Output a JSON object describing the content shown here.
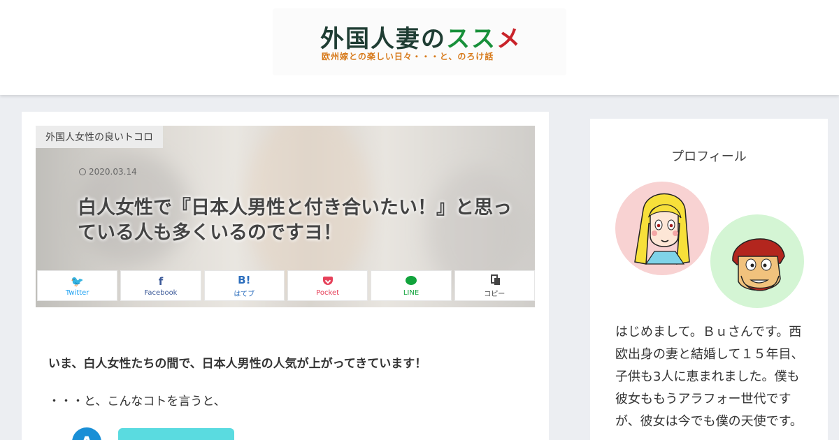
{
  "header": {
    "logo_title_main": "外国人妻の",
    "logo_title_a": "ス",
    "logo_title_b": "ス",
    "logo_title_c": "メ",
    "logo_subtitle": "欧州嫁との楽しい日々・・・と、のろけ話"
  },
  "post": {
    "category": "外国人女性の良いトコロ",
    "date": "2020.03.14",
    "title": "白人女性で『日本人男性と付き合いたい！』と思っている人も多くいるのですヨ！",
    "lead": "いま、白人女性たちの間で、日本人男性の人気が上がってきています！",
    "paragraph": "・・・と、こんなコトを言うと、",
    "speaker_initial": "A"
  },
  "share": {
    "buttons": [
      {
        "icon": "twitter-icon",
        "label": "Twitter",
        "glyph": "🐦"
      },
      {
        "icon": "facebook-icon",
        "label": "Facebook",
        "glyph": "f"
      },
      {
        "icon": "hatena-icon",
        "label": "はてブ",
        "glyph": "B!"
      },
      {
        "icon": "pocket-icon",
        "label": "Pocket"
      },
      {
        "icon": "line-icon",
        "label": "LINE"
      },
      {
        "icon": "copy-icon",
        "label": "コピー"
      }
    ],
    "colors": {
      "twitter": "#1da1f2",
      "facebook": "#3b5998",
      "hatena": "#2c6ebd",
      "pocket": "#e6415a",
      "line": "#11a33c"
    }
  },
  "sidebar": {
    "title": "プロフィール",
    "bio": "はじめまして。Ｂｕさんです。西欧出身の妻と結婚して１５年目、子供も3人に恵まれました。僕も彼女ももうアラフォー世代ですが、彼女は今でも僕の天使です。"
  }
}
